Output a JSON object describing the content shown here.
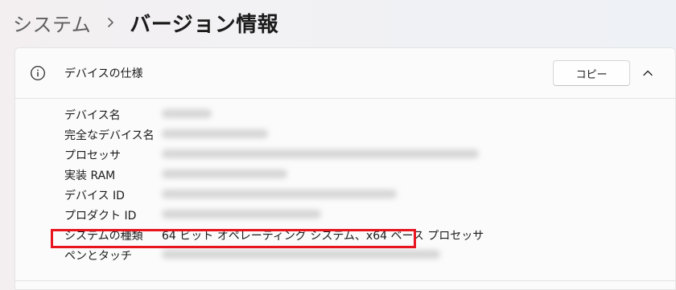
{
  "breadcrumb": {
    "parent": "システム",
    "current": "バージョン情報"
  },
  "section": {
    "title": "デバイスの仕様",
    "copy_label": "コピー"
  },
  "specs": [
    {
      "label": "デバイス名",
      "value": ""
    },
    {
      "label": "完全なデバイス名",
      "value": ""
    },
    {
      "label": "プロセッサ",
      "value": ""
    },
    {
      "label": "実装 RAM",
      "value": ""
    },
    {
      "label": "デバイス ID",
      "value": ""
    },
    {
      "label": "プロダクト ID",
      "value": ""
    },
    {
      "label": "システムの種類",
      "value": "64 ビット オペレーティング システム、x64 ベース プロセッサ"
    },
    {
      "label": "ペンとタッチ",
      "value": ""
    }
  ],
  "colors": {
    "highlight": "#e8141e"
  },
  "icons": {
    "breadcrumb_separator": "chevron-right-icon",
    "section": "info-icon",
    "collapse": "chevron-up-icon"
  }
}
